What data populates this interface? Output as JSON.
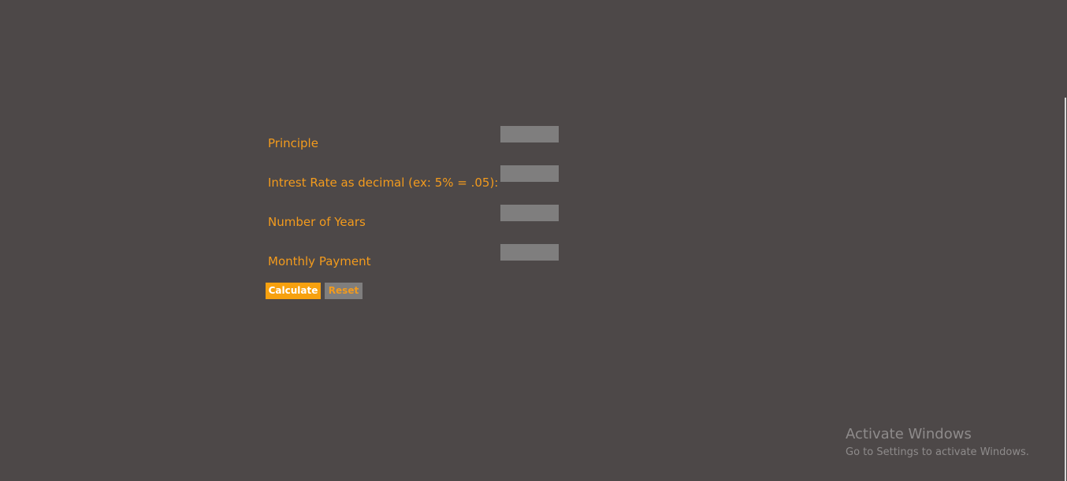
{
  "form": {
    "principle": {
      "label": "Principle",
      "value": ""
    },
    "interest_rate": {
      "label": "Intrest Rate as decimal (ex: 5% = .05):",
      "value": ""
    },
    "years": {
      "label": "Number of Years",
      "value": ""
    },
    "monthly_payment": {
      "label": "Monthly Payment",
      "value": ""
    }
  },
  "buttons": {
    "calculate_label": "Calculate",
    "reset_label": "Reset"
  },
  "watermark": {
    "title": "Activate Windows",
    "subtitle": "Go to Settings to activate Windows."
  },
  "colors": {
    "background": "#4d4848",
    "accent": "#f39b1d",
    "calculate_button": "#f7a10f",
    "input_fill": "#7f7e7e"
  }
}
